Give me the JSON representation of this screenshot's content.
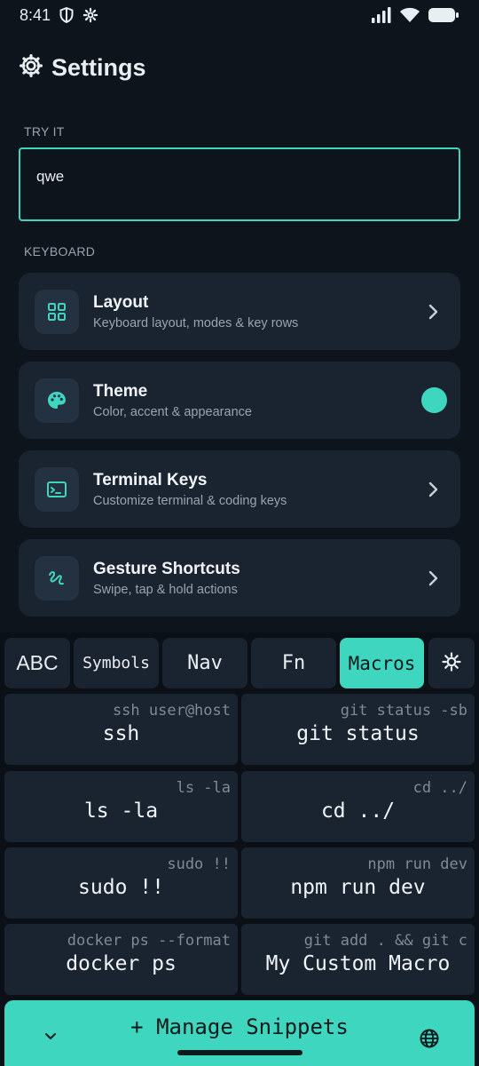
{
  "status_bar": {
    "time": "8:41",
    "icons": [
      "shield-icon",
      "gear-icon",
      "signal-icon",
      "wifi-icon",
      "battery-icon"
    ]
  },
  "header": {
    "title": "Settings",
    "icon": "gear-icon"
  },
  "try_it": {
    "label": "TRY IT",
    "value": "qwe"
  },
  "keyboard_section": {
    "label": "KEYBOARD",
    "items": [
      {
        "title": "Layout",
        "subtitle": "Keyboard layout, modes & key rows",
        "icon": "grid-icon",
        "trailing": "chevron"
      },
      {
        "title": "Theme",
        "subtitle": "Color, accent & appearance",
        "icon": "palette-icon",
        "trailing": "color-dot"
      },
      {
        "title": "Terminal Keys",
        "subtitle": "Customize terminal & coding keys",
        "icon": "terminal-icon",
        "trailing": "chevron"
      },
      {
        "title": "Gesture Shortcuts",
        "subtitle": "Swipe, tap & hold actions",
        "icon": "gesture-icon",
        "trailing": "chevron"
      }
    ]
  },
  "keyboard": {
    "tabs": [
      {
        "label": "ABC",
        "active": false
      },
      {
        "label": "Symbols",
        "active": false
      },
      {
        "label": "Nav",
        "active": false
      },
      {
        "label": "Fn",
        "active": false
      },
      {
        "label": "Macros",
        "active": true
      }
    ],
    "settings_icon": "gear-icon",
    "macros": [
      {
        "label": "ssh",
        "hint": "ssh user@host"
      },
      {
        "label": "git status",
        "hint": "git status -sb"
      },
      {
        "label": "ls -la",
        "hint": "ls -la"
      },
      {
        "label": "cd ../",
        "hint": "cd ../"
      },
      {
        "label": "sudo !!",
        "hint": "sudo !!"
      },
      {
        "label": "npm run dev",
        "hint": "npm run dev"
      },
      {
        "label": "docker ps",
        "hint": "docker ps --format"
      },
      {
        "label": "My Custom Macro",
        "hint": "git add . && git c"
      }
    ],
    "manage_button": "+ Manage Snippets",
    "collapse_icon": "chevron-down-icon",
    "language_icon": "globe-icon"
  },
  "colors": {
    "accent": "#3fd6c0",
    "background": "#0d141b",
    "card": "#1a2430"
  }
}
